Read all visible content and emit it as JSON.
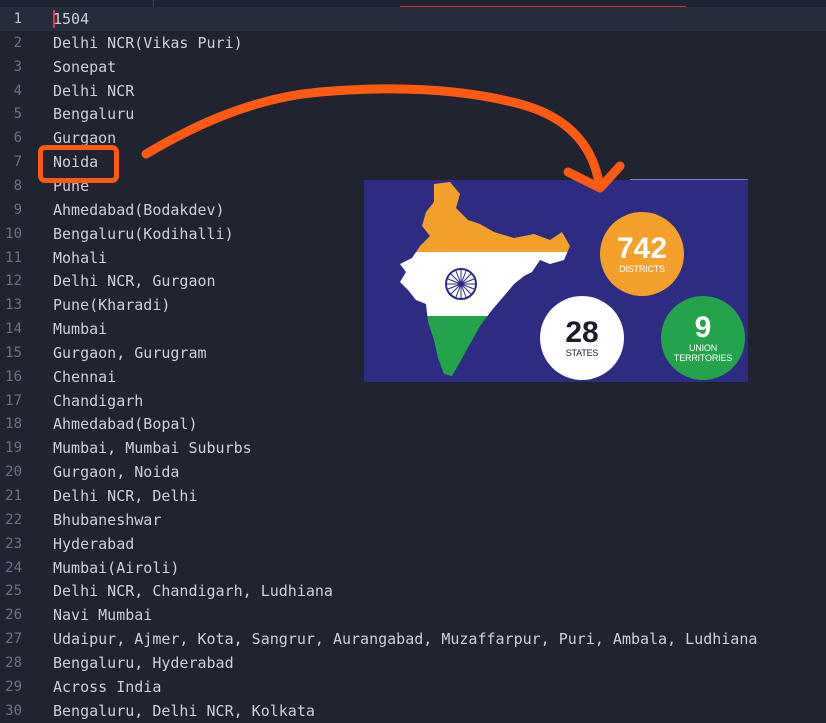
{
  "editor": {
    "lines": [
      {
        "num": "1",
        "text": "1504"
      },
      {
        "num": "2",
        "text": "Delhi NCR(Vikas Puri)"
      },
      {
        "num": "3",
        "text": "Sonepat"
      },
      {
        "num": "4",
        "text": "Delhi NCR"
      },
      {
        "num": "5",
        "text": "Bengaluru"
      },
      {
        "num": "6",
        "text": "Gurgaon"
      },
      {
        "num": "7",
        "text": "Noida"
      },
      {
        "num": "8",
        "text": "Pune"
      },
      {
        "num": "9",
        "text": "Ahmedabad(Bodakdev)"
      },
      {
        "num": "10",
        "text": "Bengaluru(Kodihalli)"
      },
      {
        "num": "11",
        "text": "Mohali"
      },
      {
        "num": "12",
        "text": "Delhi NCR, Gurgaon"
      },
      {
        "num": "13",
        "text": "Pune(Kharadi)"
      },
      {
        "num": "14",
        "text": "Mumbai"
      },
      {
        "num": "15",
        "text": "Gurgaon, Gurugram"
      },
      {
        "num": "16",
        "text": "Chennai"
      },
      {
        "num": "17",
        "text": "Chandigarh"
      },
      {
        "num": "18",
        "text": "Ahmedabad(Bopal)"
      },
      {
        "num": "19",
        "text": "Mumbai, Mumbai Suburbs"
      },
      {
        "num": "20",
        "text": "Gurgaon, Noida"
      },
      {
        "num": "21",
        "text": "Delhi NCR, Delhi"
      },
      {
        "num": "22",
        "text": "Bhubaneshwar"
      },
      {
        "num": "23",
        "text": "Hyderabad"
      },
      {
        "num": "24",
        "text": "Mumbai(Airoli)"
      },
      {
        "num": "25",
        "text": "Delhi NCR, Chandigarh, Ludhiana"
      },
      {
        "num": "26",
        "text": "Navi Mumbai"
      },
      {
        "num": "27",
        "text": "Udaipur, Ajmer, Kota, Sangrur, Aurangabad, Muzaffarpur, Puri, Ambala, Ludhiana"
      },
      {
        "num": "28",
        "text": "Bengaluru, Hyderabad"
      },
      {
        "num": "29",
        "text": "Across India"
      },
      {
        "num": "30",
        "text": "Bengaluru, Delhi NCR, Kolkata"
      }
    ],
    "active_line": 1,
    "highlighted_line": 7
  },
  "inset_stats": {
    "districts": {
      "value": "742",
      "label": "DISTRICTS"
    },
    "states": {
      "value": "28",
      "label": "STATES"
    },
    "union_territories": {
      "value": "9",
      "label_1": "UNION",
      "label_2": "TERRITORIES"
    }
  },
  "colors": {
    "editor_bg": "#1f2430",
    "annotation": "#ff5a12",
    "inset_bg": "#2e2c82",
    "saffron": "#f4a02a",
    "green": "#23a34a"
  },
  "icons": [
    "ashoka-chakra-icon",
    "india-map-icon",
    "annotation-arrow-icon"
  ]
}
